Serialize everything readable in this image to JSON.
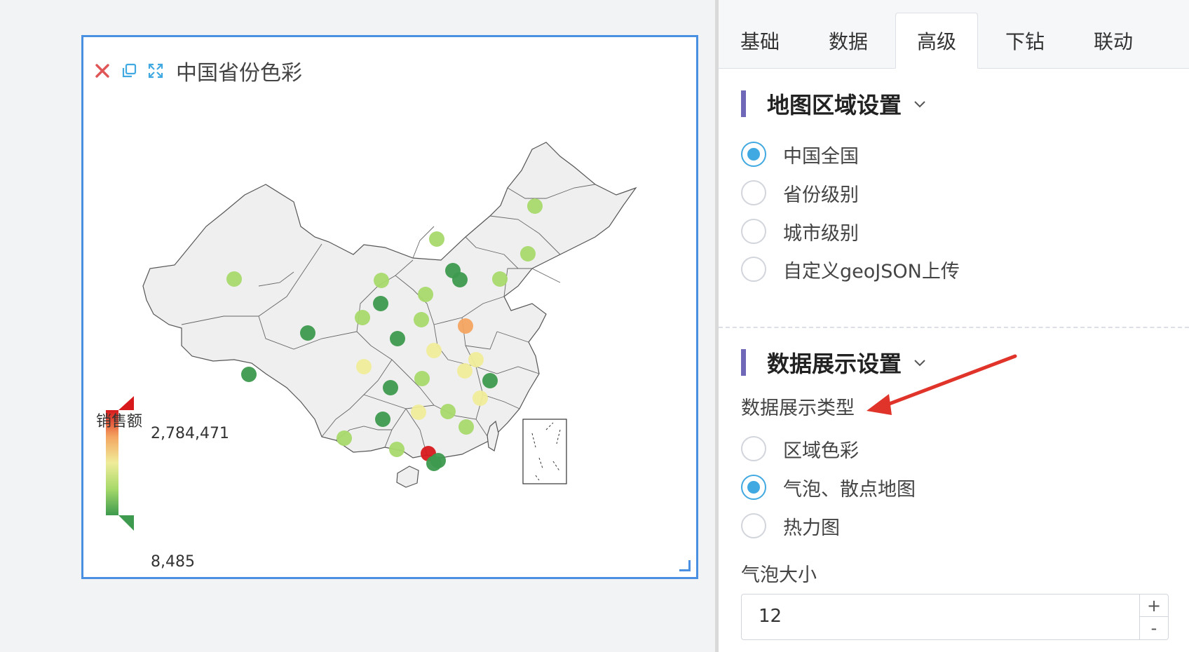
{
  "widget": {
    "title": "中国省份色彩",
    "icons": [
      "close-icon",
      "copy-icon",
      "fullscreen-icon"
    ]
  },
  "legend": {
    "title": "销售额",
    "max": "2,784,471",
    "min": "8,485",
    "colors": [
      "#d7191c",
      "#f4a460",
      "#f0ec99",
      "#a6d96a",
      "#3d9a4e"
    ]
  },
  "panel": {
    "tabs": [
      "基础",
      "数据",
      "高级",
      "下钻",
      "联动"
    ],
    "active_tab": 2,
    "region_section": {
      "title": "地图区域设置",
      "options": [
        "中国全国",
        "省份级别",
        "城市级别",
        "自定义geoJSON上传"
      ],
      "selected": 0
    },
    "display_section": {
      "title": "数据展示设置",
      "type_label": "数据展示类型",
      "options": [
        "区域色彩",
        "气泡、散点地图",
        "热力图"
      ],
      "selected": 1
    },
    "bubble": {
      "label": "气泡大小",
      "value": "12",
      "plus": "+",
      "minus": "-"
    }
  },
  "colors": {
    "accent": "#41a9e1",
    "border": "#4a90e2",
    "section_bar": "#6f67b8",
    "annotation": "#e0342a"
  }
}
